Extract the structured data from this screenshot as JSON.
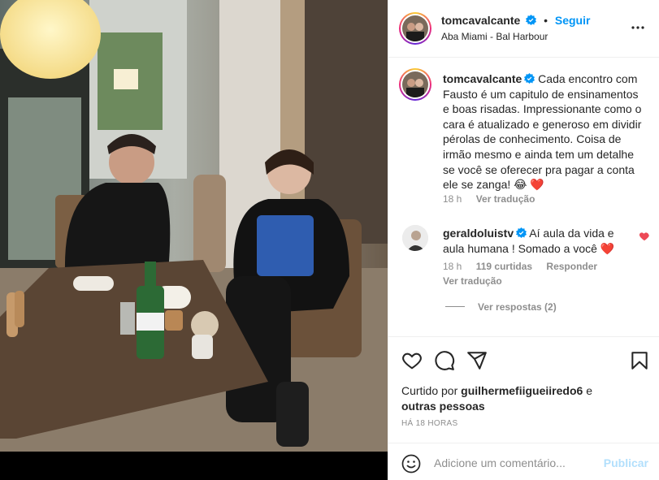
{
  "post": {
    "author": "tomcavalcante",
    "follow_label": "Seguir",
    "location": "Aba Miami - Bal Harbour",
    "separator": "•"
  },
  "caption": {
    "author": "tomcavalcante",
    "text": "Cada encontro com Fausto é um capitulo de ensinamentos e boas risadas. Impressionante como o cara é atualizado e generoso em dividir pérolas de conhecimento. Coisa de irmão mesmo e ainda tem um detalhe se você se oferecer pra pagar a conta ele se zanga! 😂 ❤️",
    "time": "18 h",
    "translate": "Ver tradução"
  },
  "comment": {
    "author": "geraldoluistv",
    "text": "Aí aula da vida e aula humana ! Somado a você ❤️",
    "time": "18 h",
    "likes": "119 curtidas",
    "reply": "Responder",
    "translate": "Ver tradução",
    "view_replies": "Ver respostas (2)"
  },
  "likes": {
    "prefix": "Curtido por",
    "user": "guilhermefiigueiiredo6",
    "suffix": "e",
    "others": "outras pessoas"
  },
  "timestamp": "HÁ 18 HORAS",
  "add_comment": {
    "placeholder": "Adicione um comentário...",
    "publish_label": "Publicar"
  },
  "icons": {
    "more": "more-options-icon",
    "like": "heart-icon",
    "comment": "comment-icon",
    "share": "share-icon",
    "save": "bookmark-icon",
    "emoji": "emoji-icon",
    "verified": "verified-badge-icon"
  },
  "colors": {
    "link": "#0095f6",
    "heart": "#ed4956",
    "publish_disabled": "#b2dffc",
    "muted": "#8e8e8e"
  }
}
